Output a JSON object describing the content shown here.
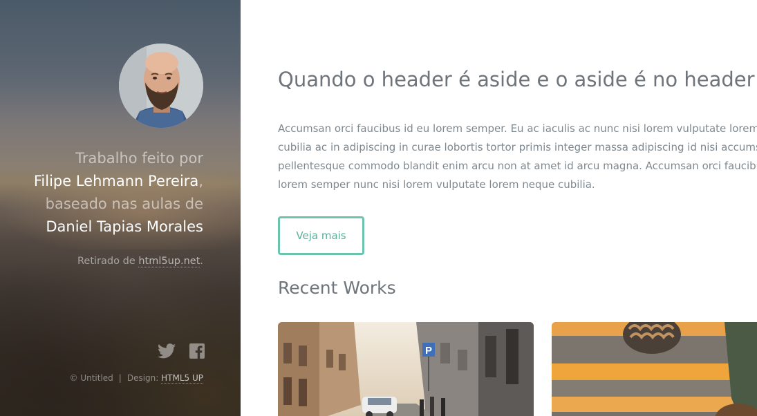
{
  "header": {
    "credits": {
      "line1": "Trabalho feito por",
      "author": "Filipe Lehmann Pereira",
      "comma": ",",
      "line3": "baseado nas aulas de",
      "teacher": "Daniel Tapias Morales"
    },
    "source": {
      "prefix": "Retirado de ",
      "link": "html5up.net",
      "suffix": "."
    },
    "social": [
      "twitter-icon",
      "facebook-icon"
    ],
    "copyright": {
      "text": "© Untitled",
      "separator": "|",
      "design_label": "Design: ",
      "design_link": "HTML5 UP"
    }
  },
  "main": {
    "title": "Quando o header é aside e o aside é no header",
    "intro_lines": [
      "Accumsan orci faucibus id eu lorem semper. Eu ac iaculis ac nunc nisi lorem vulputate lorem n",
      "cubilia ac in adipiscing in curae lobortis tortor primis integer massa adipiscing id nisi accumsa",
      "pellentesque commodo blandit enim arcu non at amet id arcu magna. Accumsan orci faucibu",
      "lorem semper nunc nisi lorem vulputate lorem neque cubilia."
    ],
    "more_button": "Veja mais",
    "section_title": "Recent Works",
    "works": [
      "street-photo",
      "stairs-photo"
    ]
  },
  "colors": {
    "accent": "#6bc4ad",
    "text": "#7f888f",
    "heading": "#6e7479"
  }
}
